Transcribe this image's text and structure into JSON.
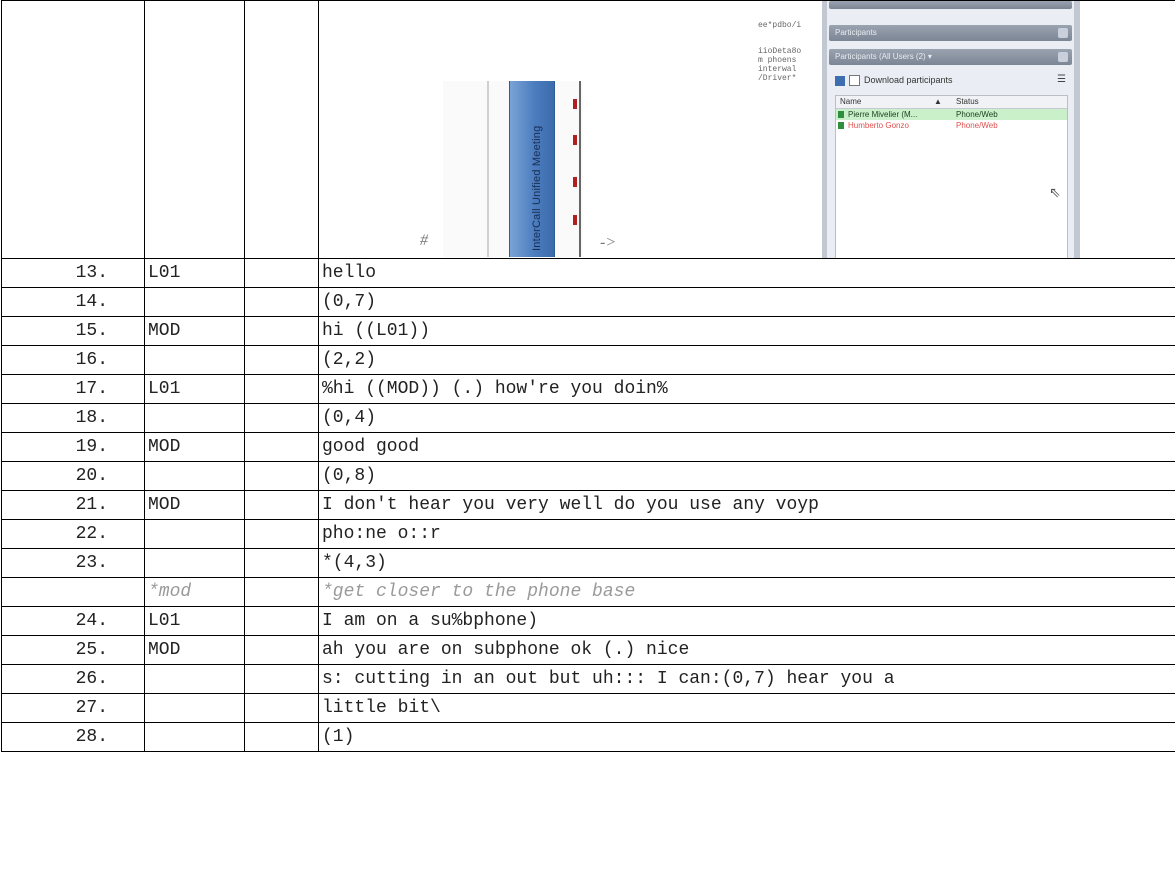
{
  "image_row": {
    "left_tab_label": "InterCall Unified Meeting",
    "hash": "#",
    "arrow": "->",
    "code_lines_1": "ee*pdbo/i",
    "code_lines_2": "iioDeta8o\nm phoens\ninterwal\n/Driver*",
    "panel": {
      "bar2": "Participants",
      "bar3": "Participants (All Users (2) ▾",
      "toolbar_text": "Download participants",
      "menu_glyph": "☰",
      "grid_header": {
        "name": "Name",
        "sort": "▲",
        "status": "Status"
      },
      "grid_rows": [
        {
          "name": "Pierre Mivelier (M...",
          "status": "Phone/Web"
        },
        {
          "name": "Humberto Gonzo",
          "status": "Phone/Web"
        }
      ],
      "cursor": "⇖"
    }
  },
  "rows": [
    {
      "num": "13.",
      "speaker": "L01",
      "text": "hello"
    },
    {
      "num": "14.",
      "speaker": "",
      "text": "(0,7)"
    },
    {
      "num": "15.",
      "speaker": "MOD",
      "text": "hi ((L01))"
    },
    {
      "num": "16.",
      "speaker": "",
      "text": "(2,2)"
    },
    {
      "num": "17.",
      "speaker": "L01",
      "text": "%hi ((MOD)) (.) how're you doin%"
    },
    {
      "num": "18.",
      "speaker": "",
      "text": "(0,4)"
    },
    {
      "num": "19.",
      "speaker": "MOD",
      "text": "good good"
    },
    {
      "num": "20.",
      "speaker": "",
      "text": "(0,8)"
    },
    {
      "num": "21.",
      "speaker": "MOD",
      "text": "I don't hear you very well do you use any voyp"
    },
    {
      "num": "22.",
      "speaker": "",
      "text": "pho:ne o::r"
    },
    {
      "num": "23.",
      "speaker": "",
      "text": "*(4,3)"
    },
    {
      "num": "",
      "speaker": "*mod",
      "text": "*get closer to the phone base",
      "note": true
    },
    {
      "num": "24.",
      "speaker": "L01",
      "text": "I am on a su%bphone)"
    },
    {
      "num": "25.",
      "speaker": "MOD",
      "text": "ah you are on subphone ok (.) nice"
    },
    {
      "num": "26.",
      "speaker": "",
      "text": "s: cutting in an out but uh::: I can:(0,7) hear you a"
    },
    {
      "num": "27.",
      "speaker": "",
      "text": "little bit\\"
    },
    {
      "num": "28.",
      "speaker": "",
      "text": "(1)"
    }
  ]
}
